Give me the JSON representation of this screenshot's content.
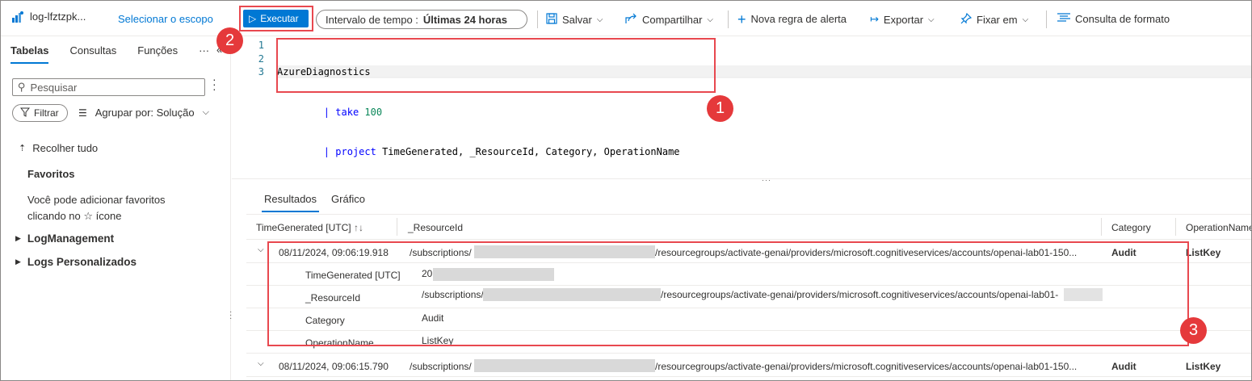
{
  "workspace": {
    "name": "log-lfztzpk..."
  },
  "toolbar": {
    "scope_link": "Selecionar o escopo",
    "run": "Executar",
    "time_label": "Intervalo de tempo :",
    "time_value": "Últimas 24 horas",
    "save": "Salvar",
    "share": "Compartilhar",
    "new_alert": "Nova regra de alerta",
    "export": "Exportar",
    "pin": "Fixar em",
    "format": "Consulta de formato"
  },
  "left": {
    "tabs": [
      "Tabelas",
      "Consultas",
      "Funções"
    ],
    "more": "···",
    "search_placeholder": "Pesquisar",
    "filter": "Filtrar",
    "group_by": "Agrupar por: Solução",
    "collapse_all": "Recolher tudo",
    "favorites_title": "Favoritos",
    "favorites_text_1": "Você pode adicionar favoritos",
    "favorites_text_2": "clicando no ☆ ícone",
    "tree": [
      "LogManagement",
      "Logs Personalizados"
    ]
  },
  "editor": {
    "line_numbers": [
      "1",
      "2",
      "3"
    ],
    "line1": "AzureDiagnostics",
    "line2_kw": "take",
    "line2_num": "100",
    "line3_kw": "project",
    "line3_rest": "TimeGenerated, _ResourceId, Category, OperationName"
  },
  "results": {
    "tabs": [
      "Resultados",
      "Gráfico"
    ],
    "columns": [
      "TimeGenerated [UTC]",
      "_ResourceId",
      "Category",
      "OperationName"
    ],
    "rows": [
      {
        "time": "08/11/2024, 09:06:19.918",
        "res_prefix": "/subscriptions/",
        "res_suffix": "/resourcegroups/activate-genai/providers/microsoft.cognitiveservices/accounts/openai-lab01-150...",
        "category": "Audit",
        "op": "ListKey"
      },
      {
        "time": "08/11/2024, 09:06:15.790",
        "res_prefix": "/subscriptions/",
        "res_suffix": "/resourcegroups/activate-genai/providers/microsoft.cognitiveservices/accounts/openai-lab01-150...",
        "category": "Audit",
        "op": "ListKey"
      }
    ],
    "details": [
      {
        "label": "TimeGenerated [UTC]",
        "value": "20"
      },
      {
        "label": "_ResourceId",
        "value_prefix": "/subscriptions/",
        "value_suffix": "/resourcegroups/activate-genai/providers/microsoft.cognitiveservices/accounts/openai-lab01-"
      },
      {
        "label": "Category",
        "value": "Audit"
      },
      {
        "label": "OperationName",
        "value": "ListKey"
      }
    ]
  },
  "badges": [
    "1",
    "2",
    "3"
  ],
  "colors": {
    "accent": "#0078d4",
    "callout": "#e5393b"
  }
}
